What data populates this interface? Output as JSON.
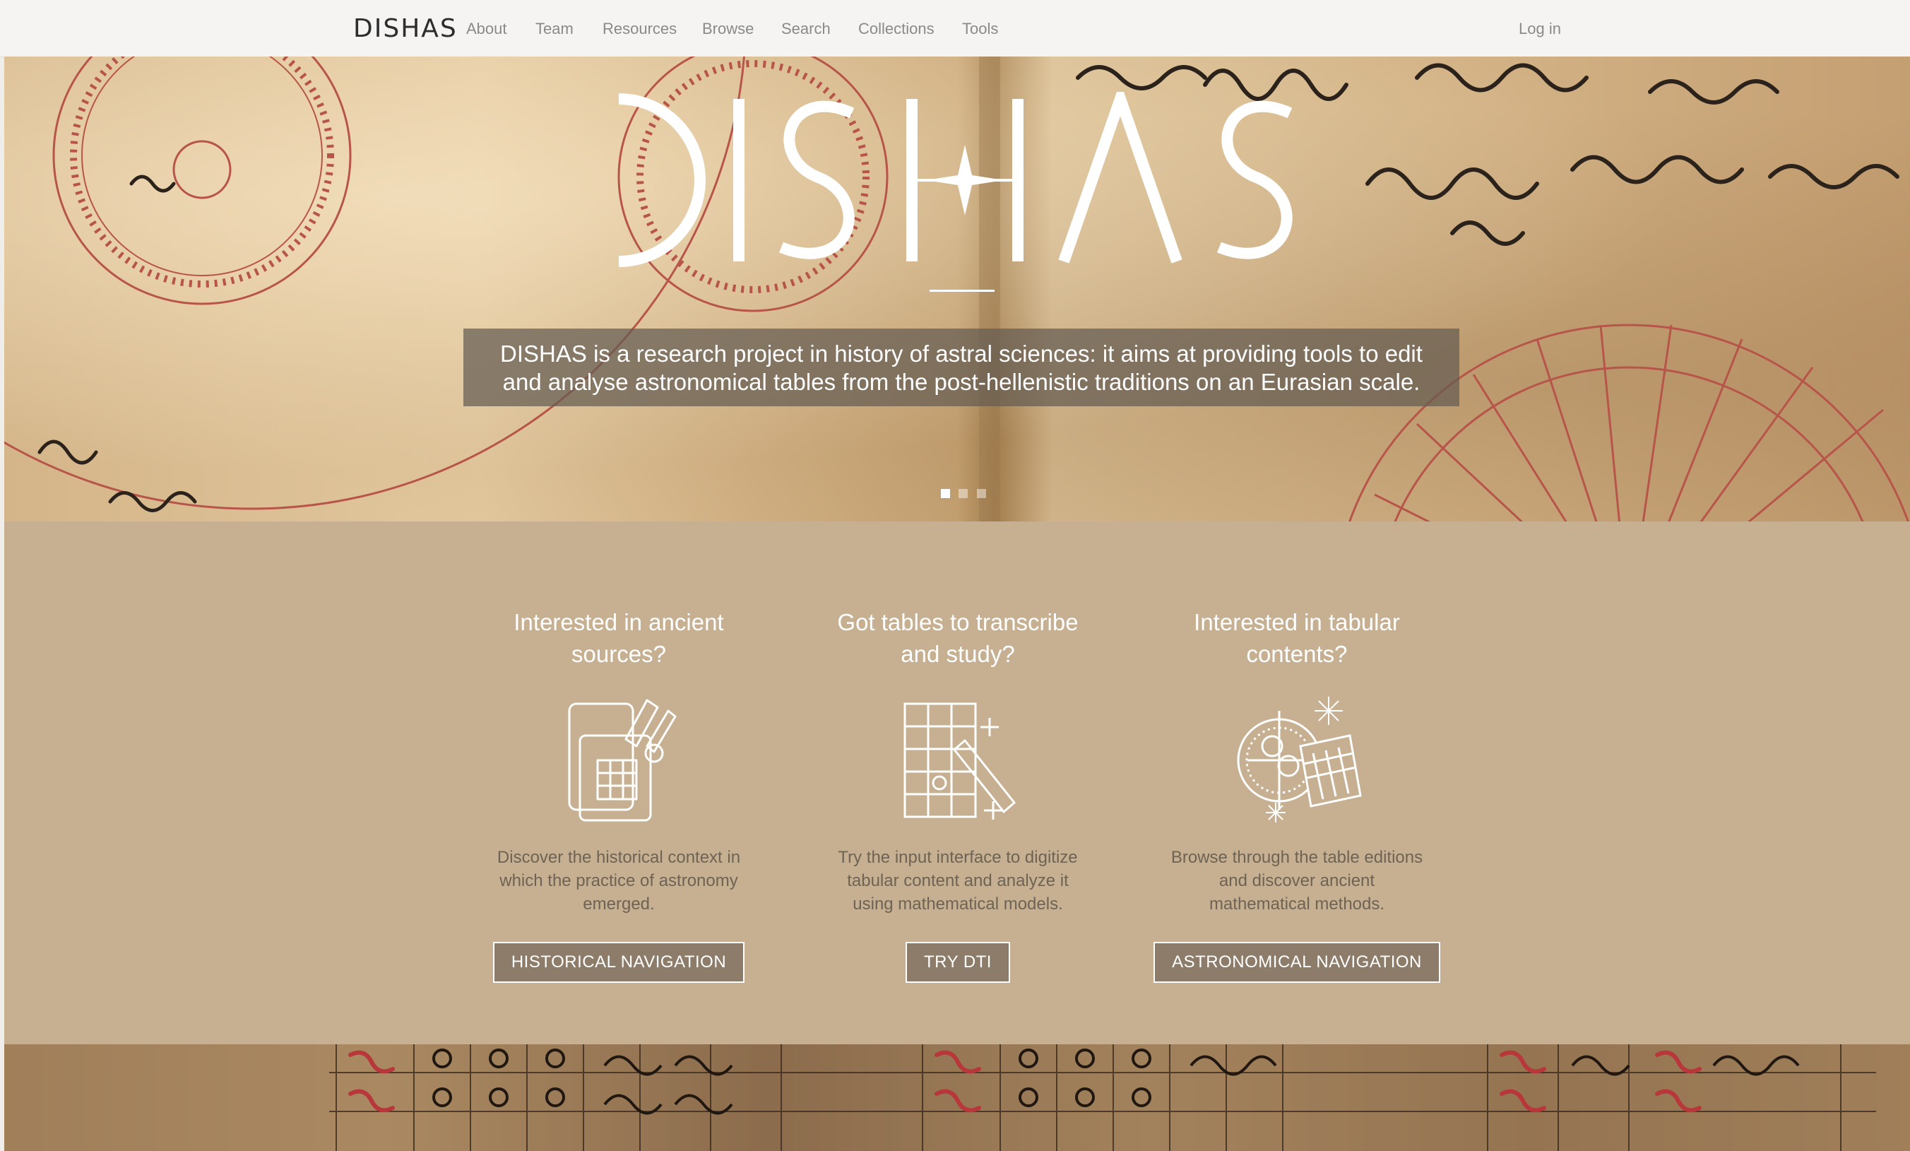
{
  "nav": {
    "logo": "DISHAS",
    "items": [
      "About",
      "Team",
      "Resources",
      "Browse",
      "Search",
      "Collections",
      "Tools"
    ],
    "login": "Log in"
  },
  "hero": {
    "title": "DISHAS",
    "caption_line1": "DISHAS is a research project in history of astral sciences: it aims at providing tools to edit",
    "caption_line2": "and analyse astronomical tables from the post-hellenistic traditions on an Eurasian scale.",
    "slides_count": 3,
    "active_slide": 1
  },
  "features": [
    {
      "title_line1": "Interested in ancient",
      "title_line2": "sources?",
      "desc_line1": "Discover the historical context in",
      "desc_line2": "which the practice of astronomy",
      "desc_line3": "emerged.",
      "button": "HISTORICAL NAVIGATION",
      "icon": "scroll-book-icon"
    },
    {
      "title_line1": "Got tables to transcribe",
      "title_line2": "and study?",
      "desc_line1": "Try the input interface to digitize",
      "desc_line2": "tabular content and analyze it",
      "desc_line3": "using mathematical models.",
      "button": "TRY DTI",
      "icon": "table-wand-icon"
    },
    {
      "title_line1": "Interested in tabular",
      "title_line2": "contents?",
      "desc_line1": "Browse through the table editions",
      "desc_line2": "and discover ancient",
      "desc_line3": "mathematical methods.",
      "button": "ASTRONOMICAL NAVIGATION",
      "icon": "astrolabe-table-icon"
    }
  ],
  "colors": {
    "navbar_bg": "#f5f4f2",
    "features_bg": "#c6b091",
    "button_bg": "#8c7c69",
    "caption_bg": "#645c52"
  }
}
